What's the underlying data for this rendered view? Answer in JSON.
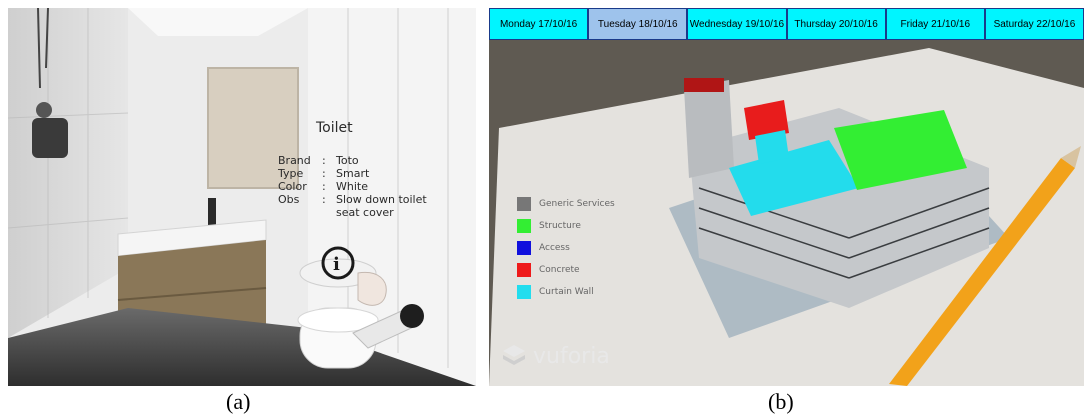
{
  "captions": {
    "a": "(a)",
    "b": "(b)"
  },
  "panel_a": {
    "title": "Toilet",
    "rows": [
      {
        "key": "Brand",
        "sep": ":",
        "value": "Toto"
      },
      {
        "key": "Type",
        "sep": ":",
        "value": "Smart"
      },
      {
        "key": "Color",
        "sep": ":",
        "value": "White"
      },
      {
        "key": "Obs",
        "sep": ":",
        "value": "Slow down toilet"
      }
    ],
    "obs_cont": "seat cover"
  },
  "panel_b": {
    "tabs": [
      {
        "label": "Monday 17/10/16",
        "active": false
      },
      {
        "label": "Tuesday 18/10/16",
        "active": true
      },
      {
        "label": "Wednesday 19/10/16",
        "active": false
      },
      {
        "label": "Thursday 20/10/16",
        "active": false
      },
      {
        "label": "Friday 21/10/16",
        "active": false
      },
      {
        "label": "Saturday 22/10/16",
        "active": false
      }
    ],
    "legend": [
      {
        "label": "Generic Services",
        "color": "#777777"
      },
      {
        "label": "Structure",
        "color": "#33ee33"
      },
      {
        "label": "Access",
        "color": "#1010dd"
      },
      {
        "label": "Concrete",
        "color": "#ee1a1a"
      },
      {
        "label": "Curtain Wall",
        "color": "#22ddee"
      }
    ],
    "brand": "vuforia",
    "colors": {
      "tab_bg": "#00f5ff",
      "tab_active": "#9ec3ec",
      "pencil": "#f2a21a"
    }
  }
}
